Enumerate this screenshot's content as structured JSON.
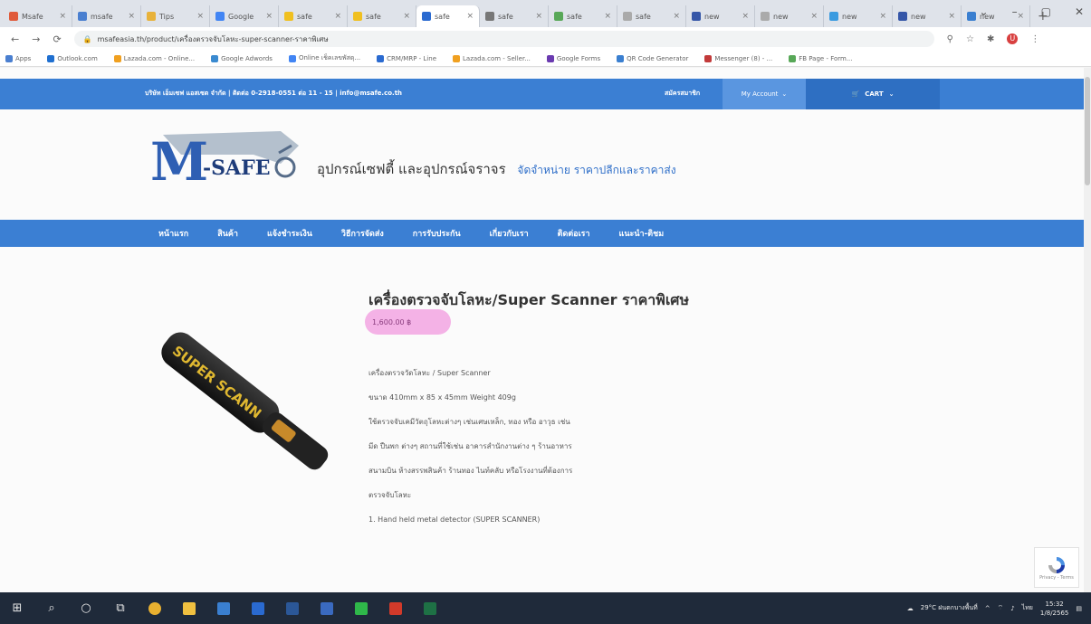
{
  "browser": {
    "tabs": [
      {
        "label": "Msafe",
        "color": "#e05a3a"
      },
      {
        "label": "msafe",
        "color": "#4a7fd0"
      },
      {
        "label": "Tips",
        "color": "#e8b23a"
      },
      {
        "label": "Google",
        "color": "#4285f4"
      },
      {
        "label": "safe",
        "color": "#f0c020"
      },
      {
        "label": "safe",
        "color": "#f0c020"
      },
      {
        "label": "safe",
        "color": "#2a6ad0"
      },
      {
        "label": "safe",
        "color": "#777777"
      },
      {
        "label": "safe",
        "color": "#58a858"
      },
      {
        "label": "safe",
        "color": "#aaaaaa"
      },
      {
        "label": "new",
        "color": "#3556a8"
      },
      {
        "label": "new",
        "color": "#aaaaaa"
      },
      {
        "label": "new",
        "color": "#3a9be0"
      },
      {
        "label": "new",
        "color": "#3556a8"
      },
      {
        "label": "new",
        "color": "#3a7fd0"
      }
    ],
    "active_tab_index": 6,
    "new_tab_symbol": "+",
    "window_controls": [
      "⌄",
      "–",
      "▢",
      "✕"
    ],
    "address": "msafeasia.th/product/เครื่องตรวจจับโลหะ-super-scanner-ราคาพิเศษ",
    "bookmarks": [
      {
        "label": "Apps",
        "color": "#4a7fd0"
      },
      {
        "label": "Outlook.com",
        "color": "#1f6fd0"
      },
      {
        "label": "Lazada.com - Online...",
        "color": "#f0a020"
      },
      {
        "label": "Google Adwords",
        "color": "#3a8ad0"
      },
      {
        "label": "Online เช็คเลขพัสดุ...",
        "color": "#4285f4"
      },
      {
        "label": "CRM/MRP - Line",
        "color": "#2a6ad0"
      },
      {
        "label": "Lazada.com - Seller...",
        "color": "#f0a020"
      },
      {
        "label": "Google Forms",
        "color": "#6a3ab0"
      },
      {
        "label": "QR Code Generator",
        "color": "#3a7fd0"
      },
      {
        "label": "Messenger (8) - ...",
        "color": "#c23a3a"
      },
      {
        "label": "FB Page - Form...",
        "color": "#58a858"
      }
    ]
  },
  "site": {
    "contact_line": "บริษัท เอ็มเซฟ แอสเซต จำกัด | ติดต่อ 0-2918-0551 ต่อ 11 - 15 | info@msafe.co.th",
    "signup": "สมัครสมาชิก",
    "my_account": "My Account",
    "cart": "CART",
    "logo_text": "M-SAFE",
    "tagline": "อุปกรณ์เซฟตี้ และอุปกรณ์จราจร",
    "tagline_blue": "จัดจำหน่าย ราคาปลีกและราคาส่ง",
    "nav": [
      "หน้าแรก",
      "สินค้า",
      "แจ้งชำระเงิน",
      "วิธีการจัดส่ง",
      "การรับประกัน",
      "เกี่ยวกับเรา",
      "ติดต่อเรา",
      "แนะนำ-ติชม"
    ],
    "product_title": "เครื่องตรวจจับโลหะ/Super Scanner ราคาพิเศษ",
    "price": "1,600.00 ฿",
    "product_image_label": "SUPER SCANN",
    "description": [
      "เครื่องตรวจวัดโลหะ / Super Scanner",
      "ขนาด 410mm x 85 x 45mm Weight 409g",
      "ใช้ตรวจจับเคมีวัตถุโลหะต่างๆ เช่นเศษเหล็ก, ทอง หรือ อาวุธ เช่น",
      "มีด ปืนพก ต่างๆ สถานที่ใช้เช่น อาคารสำนักงานต่าง ๆ ร้านอาหาร",
      "สนามบิน ห้างสรรพสินค้า ร้านทอง ไนท์คลับ หรือโรงงานที่ต้องการ",
      "ตรวจจับโลหะ",
      "1. Hand held metal detector (SUPER SCANNER)"
    ],
    "recaptcha": "Privacy - Terms"
  },
  "taskbar": {
    "weather": "29°C ฝนตกบางพื้นที่",
    "lang": "ไทย",
    "time": "15:32",
    "date": "1/8/2565"
  },
  "colors": {
    "site_blue": "#3b7fd3",
    "price_highlight": "#f4b2e6"
  }
}
